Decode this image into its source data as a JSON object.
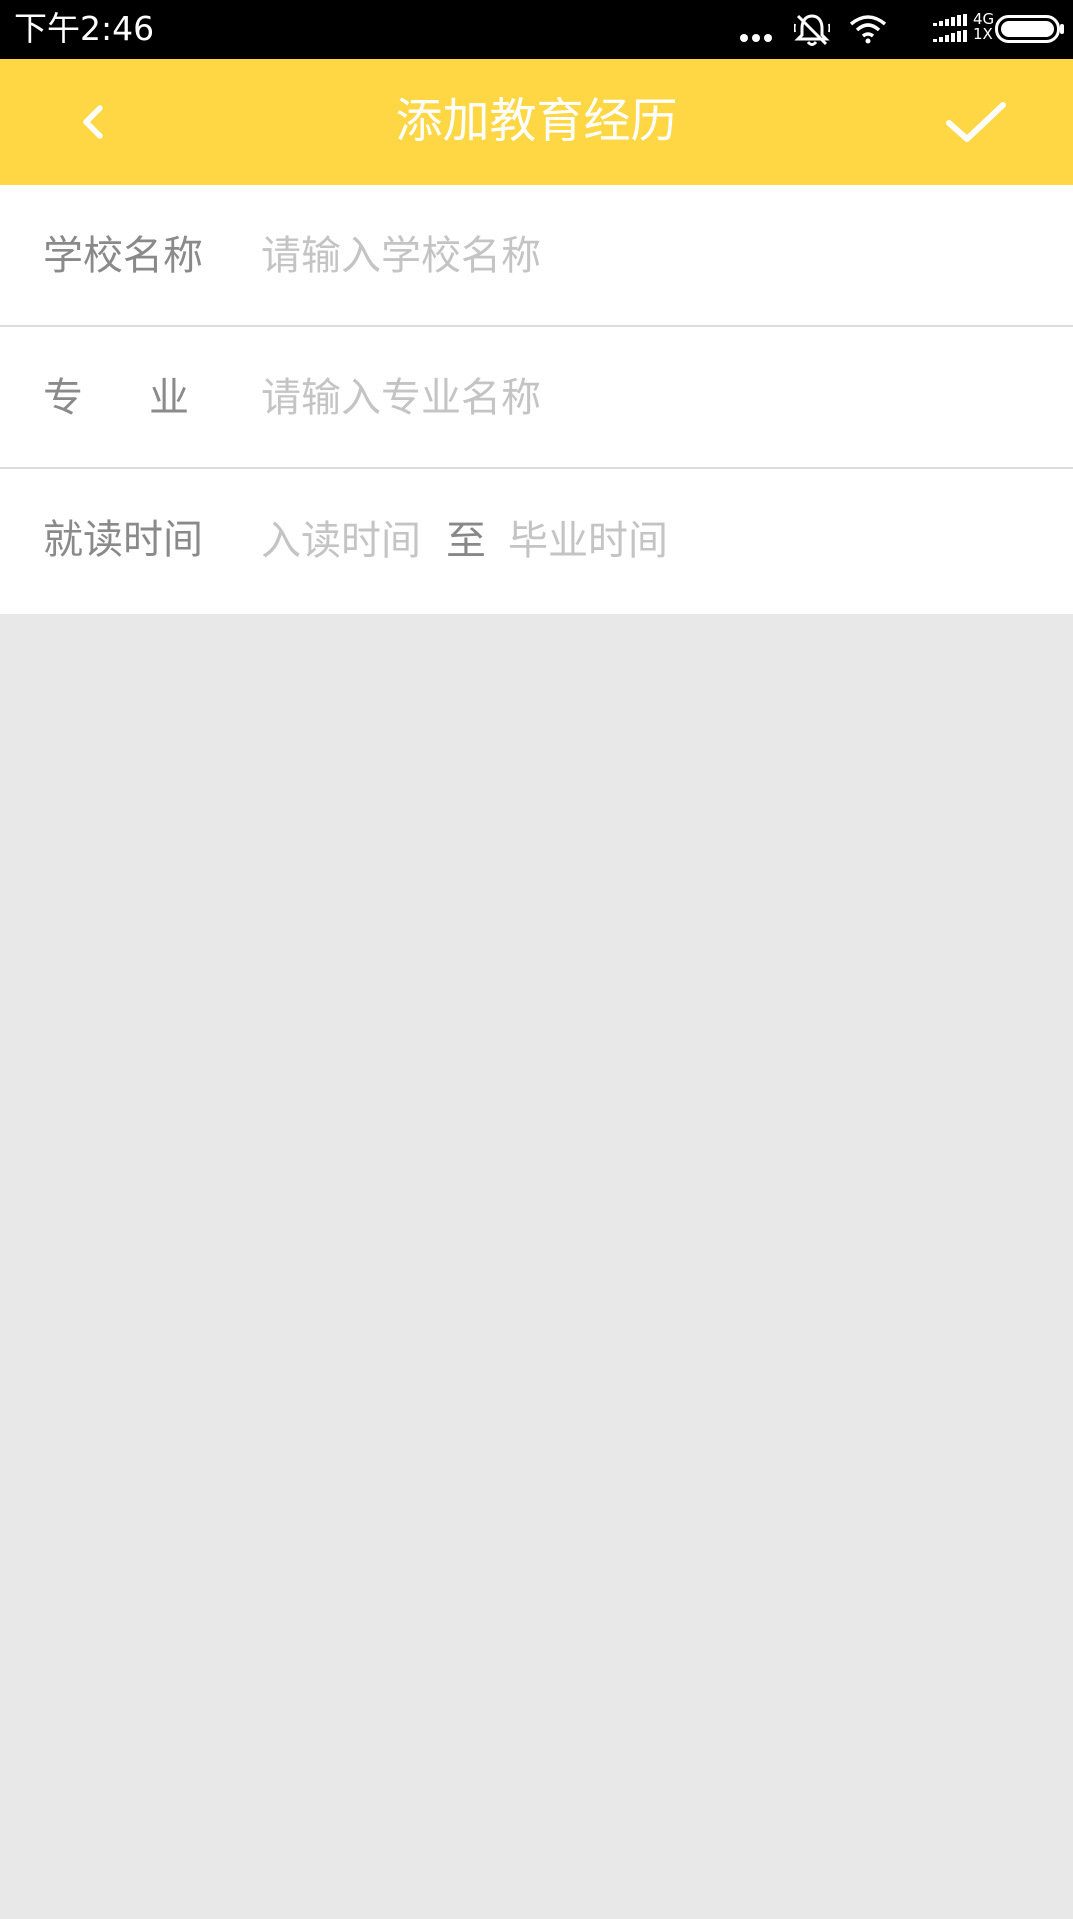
{
  "status_bar": {
    "time": "下午2:46",
    "network_type": "4G",
    "network_sub": "1X",
    "icons": [
      "more-dots-icon",
      "silent-bell-icon",
      "wifi-icon",
      "signal-icon",
      "battery-icon"
    ]
  },
  "app_bar": {
    "title": "添加教育经历",
    "back_icon": "chevron-left-icon",
    "confirm_icon": "checkmark-icon",
    "background_color": "#ffd744"
  },
  "form": {
    "school": {
      "label": "学校名称",
      "placeholder": "请输入学校名称"
    },
    "major": {
      "label_first": "专",
      "label_second": "业",
      "placeholder": "请输入专业名称"
    },
    "period": {
      "label": "就读时间",
      "start_placeholder": "入读时间",
      "separator": "至",
      "end_placeholder": "毕业时间"
    }
  },
  "colors": {
    "label": "#8a8a8a",
    "placeholder": "#c4c4c4",
    "page_background": "#e8e8e8"
  }
}
